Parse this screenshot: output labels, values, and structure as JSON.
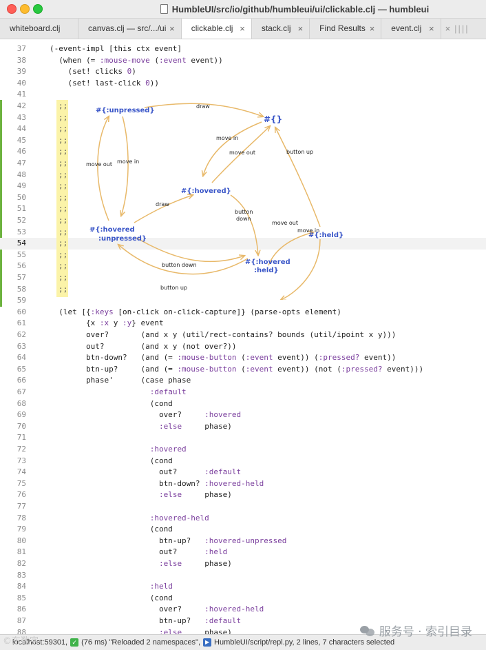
{
  "window": {
    "title": "HumbleUI/src/io/github/humbleui/ui/clickable.clj — humbleui"
  },
  "tabs": [
    {
      "label": "whiteboard.clj",
      "active": false,
      "close_icon": "close-icon"
    },
    {
      "label": "canvas.clj — src/.../ui",
      "active": false
    },
    {
      "label": "clickable.clj",
      "active": true
    },
    {
      "label": "stack.clj",
      "active": false
    },
    {
      "label": "Find Results",
      "active": false
    },
    {
      "label": "event.clj",
      "active": false
    }
  ],
  "tab_close": "×",
  "tab_overflow": "||||",
  "colors": {
    "keyword": "#7a3e9d",
    "diagram_arrow": "#e8b96a",
    "diagram_node": "#3a56c8",
    "comment_bg": "#fbf3a8",
    "gutter_change": "#6db33f"
  },
  "code_lines": [
    {
      "n": "37",
      "text": "(-event-impl [this ctx event]"
    },
    {
      "n": "38",
      "text": "  (when (= :mouse-move (:event event))"
    },
    {
      "n": "39",
      "text": "    (set! clicks 0)"
    },
    {
      "n": "40",
      "text": "    (set! last-click 0))"
    },
    {
      "n": "41",
      "text": ""
    },
    {
      "n": "42",
      "text": ""
    },
    {
      "n": "43",
      "text": ""
    },
    {
      "n": "44",
      "text": ""
    },
    {
      "n": "45",
      "text": ""
    },
    {
      "n": "46",
      "text": ""
    },
    {
      "n": "47",
      "text": ""
    },
    {
      "n": "48",
      "text": ""
    },
    {
      "n": "49",
      "text": ""
    },
    {
      "n": "50",
      "text": ""
    },
    {
      "n": "51",
      "text": ""
    },
    {
      "n": "52",
      "text": ""
    },
    {
      "n": "53",
      "text": ""
    },
    {
      "n": "54",
      "text": ""
    },
    {
      "n": "55",
      "text": ""
    },
    {
      "n": "56",
      "text": ""
    },
    {
      "n": "57",
      "text": ""
    },
    {
      "n": "58",
      "text": ""
    },
    {
      "n": "59",
      "text": ""
    },
    {
      "n": "60",
      "text": "  (let [{:keys [on-click on-click-capture]} (parse-opts element)"
    },
    {
      "n": "61",
      "text": "        {x :x y :y} event"
    },
    {
      "n": "62",
      "text": "        over?       (and x y (util/rect-contains? bounds (util/ipoint x y)))"
    },
    {
      "n": "63",
      "text": "        out?        (and x y (not over?))"
    },
    {
      "n": "64",
      "text": "        btn-down?   (and (= :mouse-button (:event event)) (:pressed? event))"
    },
    {
      "n": "65",
      "text": "        btn-up?     (and (= :mouse-button (:event event)) (not (:pressed? event)))"
    },
    {
      "n": "66",
      "text": "        phase'      (case phase"
    },
    {
      "n": "67",
      "text": "                      :default"
    },
    {
      "n": "68",
      "text": "                      (cond"
    },
    {
      "n": "69",
      "text": "                        over?     :hovered"
    },
    {
      "n": "70",
      "text": "                        :else     phase)"
    },
    {
      "n": "71",
      "text": ""
    },
    {
      "n": "72",
      "text": "                      :hovered"
    },
    {
      "n": "73",
      "text": "                      (cond"
    },
    {
      "n": "74",
      "text": "                        out?      :default"
    },
    {
      "n": "75",
      "text": "                        btn-down? :hovered-held"
    },
    {
      "n": "76",
      "text": "                        :else     phase)"
    },
    {
      "n": "77",
      "text": ""
    },
    {
      "n": "78",
      "text": "                      :hovered-held"
    },
    {
      "n": "79",
      "text": "                      (cond"
    },
    {
      "n": "80",
      "text": "                        btn-up?   :hovered-unpressed"
    },
    {
      "n": "81",
      "text": "                        out?      :held"
    },
    {
      "n": "82",
      "text": "                        :else     phase)"
    },
    {
      "n": "83",
      "text": ""
    },
    {
      "n": "84",
      "text": "                      :held"
    },
    {
      "n": "85",
      "text": "                      (cond"
    },
    {
      "n": "86",
      "text": "                        over?     :hovered-held"
    },
    {
      "n": "87",
      "text": "                        btn-up?   :default"
    },
    {
      "n": "88",
      "text": "                        :else     phase)"
    }
  ],
  "current_line": "54",
  "comment_marker": ";;",
  "diagram": {
    "nodes": {
      "unpressed": "#{:unpressed}",
      "empty": "#{}",
      "hovered": "#{:hovered}",
      "held": "#{:held}",
      "hovered_unpressed_1": "#{:hovered",
      "hovered_unpressed_2": ":unpressed}",
      "hovered_held_1": "#{:hovered",
      "hovered_held_2": ":held}"
    },
    "edges": {
      "draw_top": "draw",
      "move_in_1": "move in",
      "move_out_1": "move out",
      "move_out_left": "move out",
      "move_in_left": "move in",
      "button_up_right": "button up",
      "draw_mid": "draw",
      "button_down_mid_1": "button",
      "button_down_mid_2": "down",
      "move_out_right": "move out",
      "move_in_right": "move in",
      "button_down_bottom": "button down",
      "button_up_bottom": "button up"
    }
  },
  "status": {
    "left_prefix": "localhost:59301,",
    "time": "(76 ms) \"Reloaded 2 namespaces\",",
    "script": "HumbleUI/script/repl.py, 2 lines, 7 characters selected",
    "watermark": "服务号 · 索引目录",
    "watermark_left": "©东数字"
  }
}
